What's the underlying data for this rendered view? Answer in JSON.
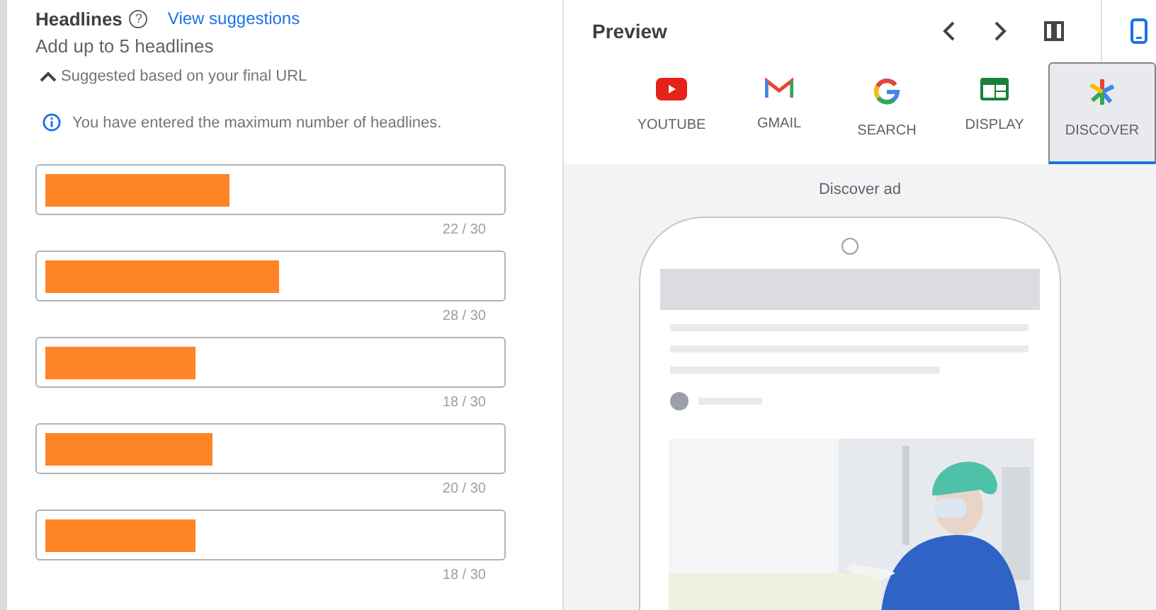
{
  "headlines_section": {
    "title": "Headlines",
    "help": "?",
    "link": "View suggestions",
    "subtitle": "Add up to 5 headlines",
    "suggested_toggle": {
      "label": "Suggested based on your final URL",
      "expanded": true
    },
    "info": "You have entered the maximum number of headlines.",
    "headlines": [
      {
        "redacted": true,
        "counter": "22 / 30"
      },
      {
        "redacted": true,
        "counter": "28 / 30"
      },
      {
        "redacted": true,
        "counter": "18 / 30"
      },
      {
        "redacted": true,
        "counter": "20 / 30"
      },
      {
        "redacted": true,
        "counter": "18 / 30"
      }
    ]
  },
  "preview": {
    "title": "Preview",
    "tabs": [
      {
        "kind": "youtube",
        "label": "YOUTUBE",
        "selected": false
      },
      {
        "kind": "gmail",
        "label": "GMAIL",
        "selected": false
      },
      {
        "kind": "search",
        "label": "SEARCH",
        "selected": false
      },
      {
        "kind": "display",
        "label": "DISPLAY",
        "selected": false
      },
      {
        "kind": "discover",
        "label": "DISCOVER",
        "selected": true
      }
    ],
    "caption": "Discover ad"
  }
}
